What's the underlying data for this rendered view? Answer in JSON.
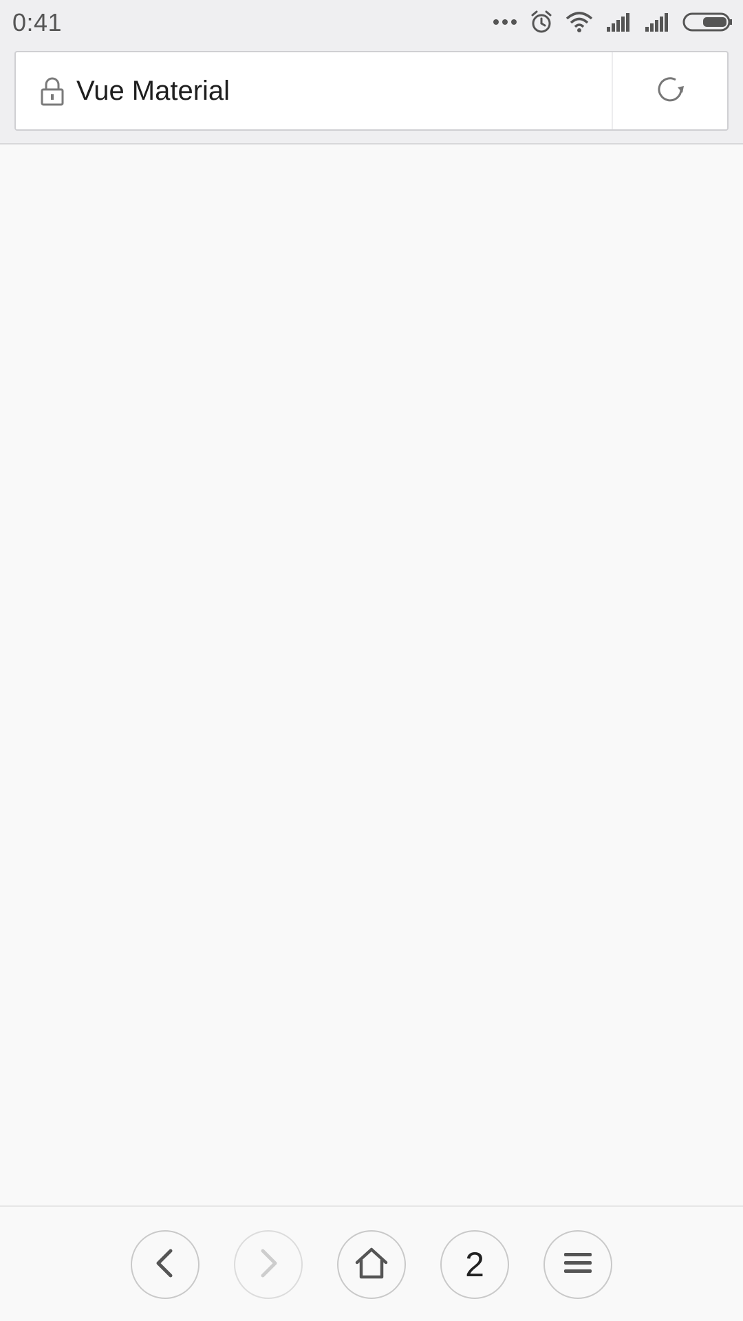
{
  "status_bar": {
    "time": "0:41",
    "icons": [
      "more-dots-icon",
      "alarm-icon",
      "wifi-icon",
      "signal-icon",
      "signal-icon",
      "battery-icon"
    ]
  },
  "address_bar": {
    "security_icon": "lock-icon",
    "title": "Vue Material",
    "reload_icon": "reload-icon"
  },
  "toolbar": {
    "back_icon": "chevron-left-icon",
    "forward_icon": "chevron-right-icon",
    "home_icon": "home-icon",
    "tabs_count": "2",
    "menu_icon": "menu-icon"
  },
  "colors": {
    "background": "#f9f9f9",
    "chrome": "#efeff1",
    "icon": "#555555",
    "icon_disabled": "#c8c8c8"
  }
}
